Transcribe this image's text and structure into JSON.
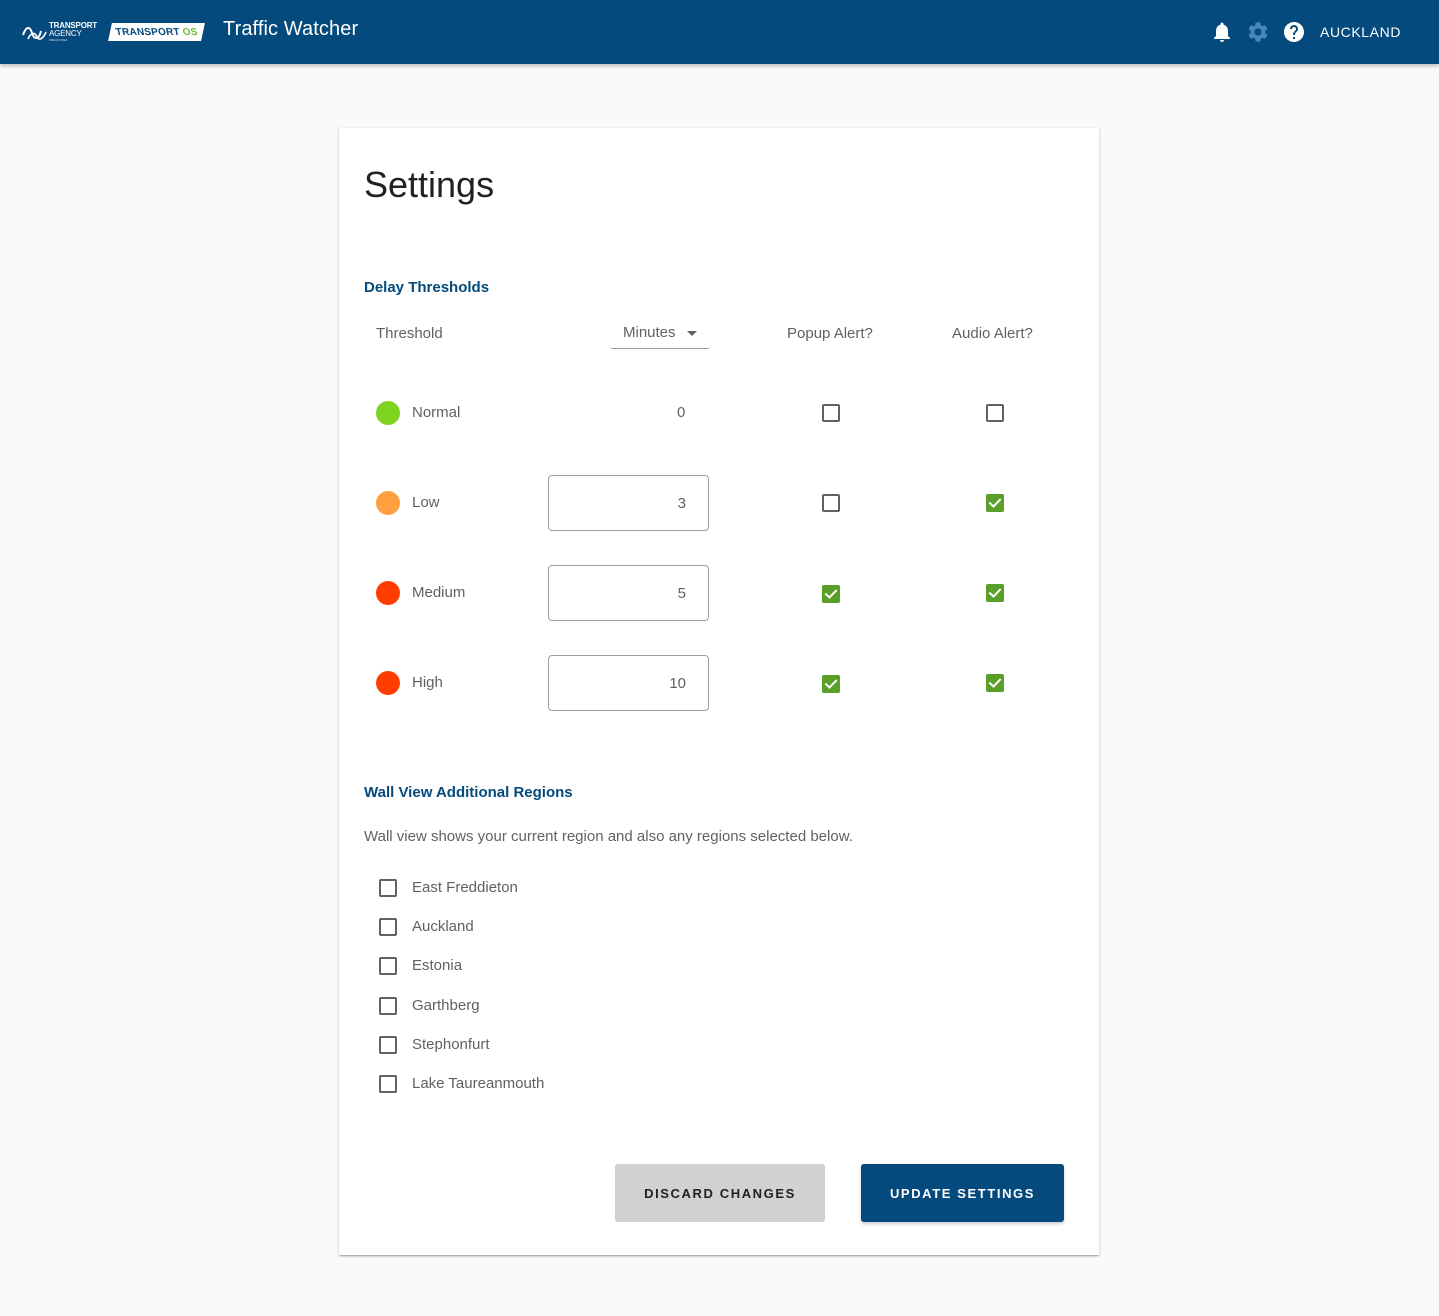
{
  "header": {
    "logo_nzta_line1": "TRANSPORT",
    "logo_nzta_line2": "AGENCY",
    "logo_nzta_line3": "WAKA KOTAHI",
    "logo_tos_main": "TRANSPORT",
    "logo_tos_os": "OS",
    "app_title": "Traffic Watcher",
    "region": "AUCKLAND",
    "icons": [
      "bell-icon",
      "gear-icon",
      "help-icon"
    ]
  },
  "settings": {
    "title": "Settings",
    "delay_section_title": "Delay Thresholds",
    "columns": {
      "threshold": "Threshold",
      "minutes": "Minutes",
      "popup": "Popup Alert?",
      "audio": "Audio Alert?"
    },
    "thresholds": [
      {
        "label": "Normal",
        "value": "0",
        "popup": false,
        "audio": false,
        "color": "#7ed321"
      },
      {
        "label": "Low",
        "value": "3",
        "popup": false,
        "audio": true,
        "color": "#ffa040"
      },
      {
        "label": "Medium",
        "value": "5",
        "popup": true,
        "audio": true,
        "color": "#ff3d00"
      },
      {
        "label": "High",
        "value": "10",
        "popup": true,
        "audio": true,
        "color": "#ff3d00"
      }
    ],
    "wall_section_title": "Wall View Additional Regions",
    "wall_description": "Wall view shows your current region and also any regions selected below.",
    "regions": [
      {
        "name": "East Freddieton",
        "checked": false
      },
      {
        "name": "Auckland",
        "checked": false
      },
      {
        "name": "Estonia",
        "checked": false
      },
      {
        "name": "Garthberg",
        "checked": false
      },
      {
        "name": "Stephonfurt",
        "checked": false
      },
      {
        "name": "Lake Taureanmouth",
        "checked": false
      }
    ],
    "discard_label": "DISCARD CHANGES",
    "update_label": "UPDATE SETTINGS"
  },
  "colors": {
    "brand": "#044a7c",
    "checked": "#5a9e2a",
    "background": "#fafafa"
  }
}
